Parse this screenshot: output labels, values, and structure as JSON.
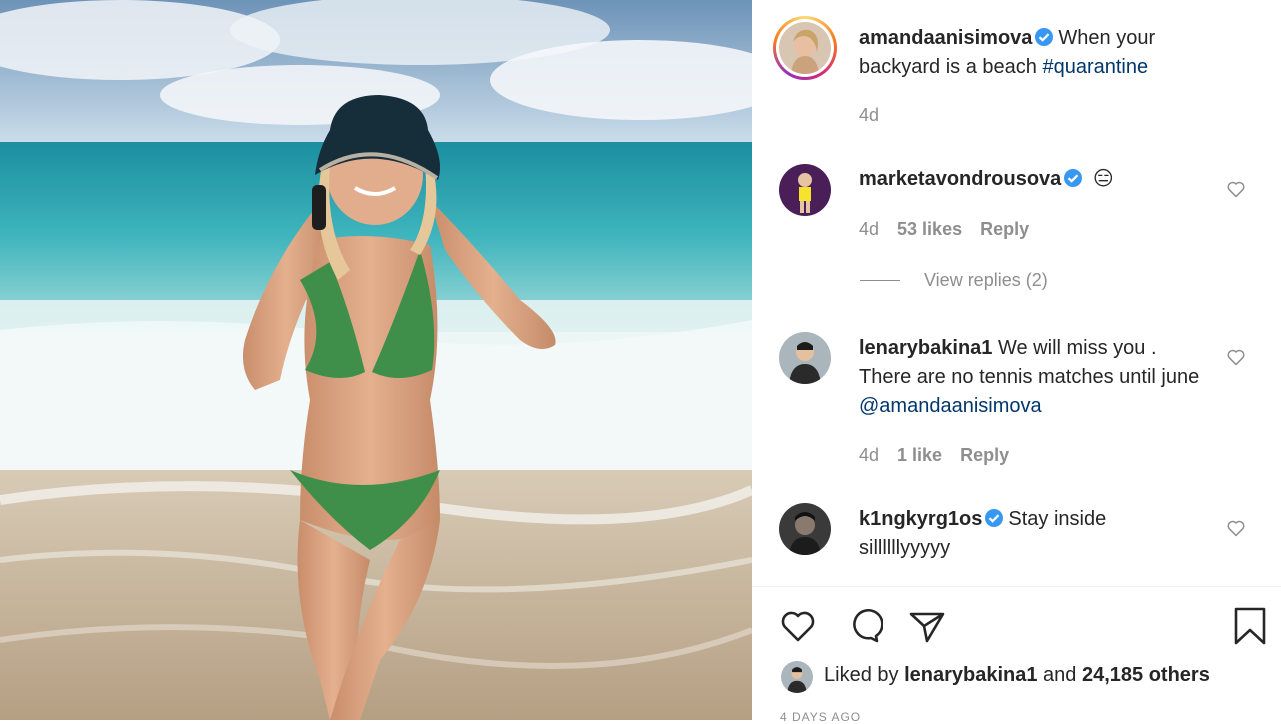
{
  "post": {
    "author": "amandaanisimova",
    "caption_text": "When your backyard is a beach",
    "caption_hashtag": "#quarantine",
    "time": "4d"
  },
  "comments": [
    {
      "username": "marketavondrousova",
      "verified": true,
      "text": "😑",
      "time": "4d",
      "likes": "53 likes",
      "reply": "Reply"
    },
    {
      "username": "lenarybakina1",
      "verified": false,
      "text": "We will miss you . There are no tennis matches until june",
      "mention": "@amandaanisimova",
      "time": "4d",
      "likes": "1 like",
      "reply": "Reply"
    },
    {
      "username": "k1ngkyrg1os",
      "verified": true,
      "text": "Stay inside sillllllyyyyy"
    }
  ],
  "view_replies": "View replies (2)",
  "likes_summary": {
    "prefix": "Liked by",
    "user": "lenarybakina1",
    "and": "and",
    "others": "24,185 others"
  },
  "date_label": "4 DAYS AGO",
  "colors": {
    "verified": "#3897f0",
    "hashtag": "#00376b",
    "meta": "#8e8e8e"
  },
  "icons": [
    "like-icon",
    "comment-icon",
    "share-icon",
    "bookmark-icon",
    "verified-badge-icon"
  ]
}
